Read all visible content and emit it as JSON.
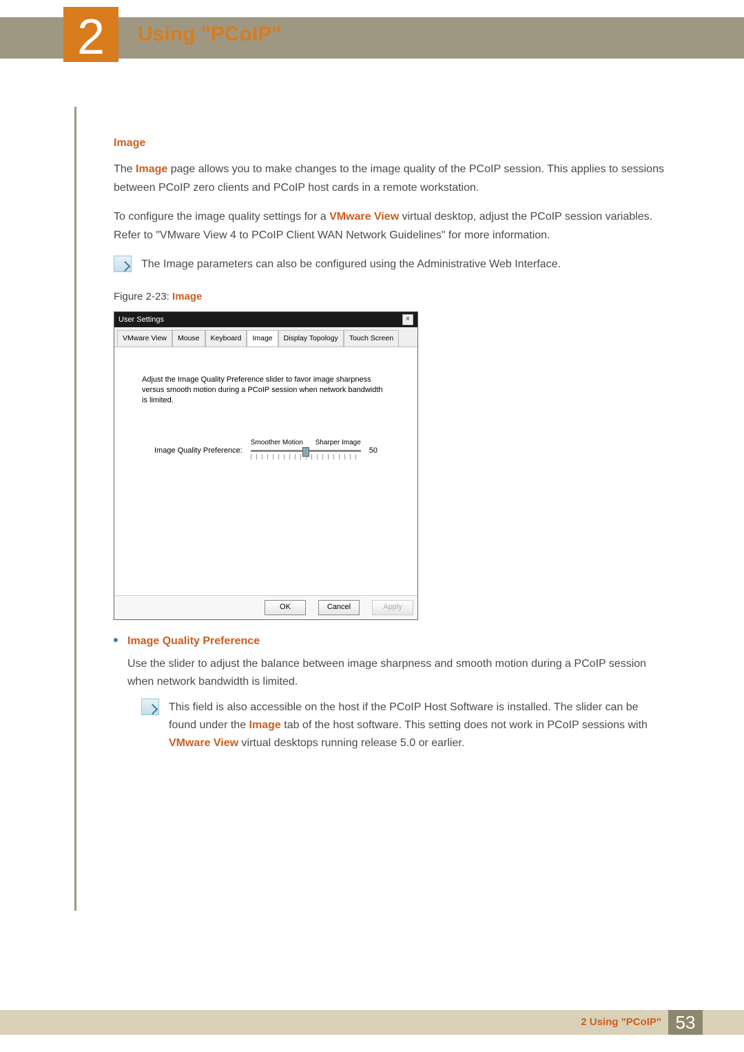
{
  "chapter": {
    "num": "2",
    "title": "Using \"PCoIP\""
  },
  "section": {
    "heading": "Image",
    "para1_a": "The ",
    "para1_hl1": "Image",
    "para1_b": " page allows you to make changes to the image quality of the PCoIP session. This applies to sessions between PCoIP zero clients and PCoIP host cards in a remote workstation.",
    "para2_a": "To configure the image quality settings for a ",
    "para2_hl1": "VMware View",
    "para2_b": " virtual desktop, adjust the PCoIP session variables. Refer to \"VMware View 4 to PCoIP Client WAN Network Guidelines\" for more information.",
    "note1": "The Image parameters can also be configured using the Administrative Web Interface.",
    "fig_prefix": "Figure 2-23: ",
    "fig_name": "Image"
  },
  "dialog": {
    "title": "User Settings",
    "tabs": [
      "VMware View",
      "Mouse",
      "Keyboard",
      "Image",
      "Display Topology",
      "Touch Screen"
    ],
    "active_tab": 3,
    "desc": "Adjust the Image Quality Preference slider to favor image sharpness versus smooth motion during a PCoIP session when network bandwidth is limited.",
    "slider_label": "Image Quality Preference:",
    "slider_min": "Smoother Motion",
    "slider_max": "Sharper Image",
    "slider_value": "50",
    "buttons": {
      "ok": "OK",
      "cancel": "Cancel",
      "apply": "Apply"
    }
  },
  "bullet": {
    "title": "Image Quality Preference",
    "text": "Use the slider to adjust the balance between image sharpness and smooth motion during a PCoIP session when network bandwidth is limited.",
    "note_a": "This field is also accessible on the host if the PCoIP Host Software is installed. The slider can be found under the ",
    "note_hl1": "Image",
    "note_b": " tab of the host software. This setting does not work in PCoIP sessions with ",
    "note_hl2": "VMware View",
    "note_c": " virtual desktops running release 5.0 or earlier."
  },
  "footer": {
    "label": "2 Using \"PCoIP\"",
    "page": "53"
  }
}
